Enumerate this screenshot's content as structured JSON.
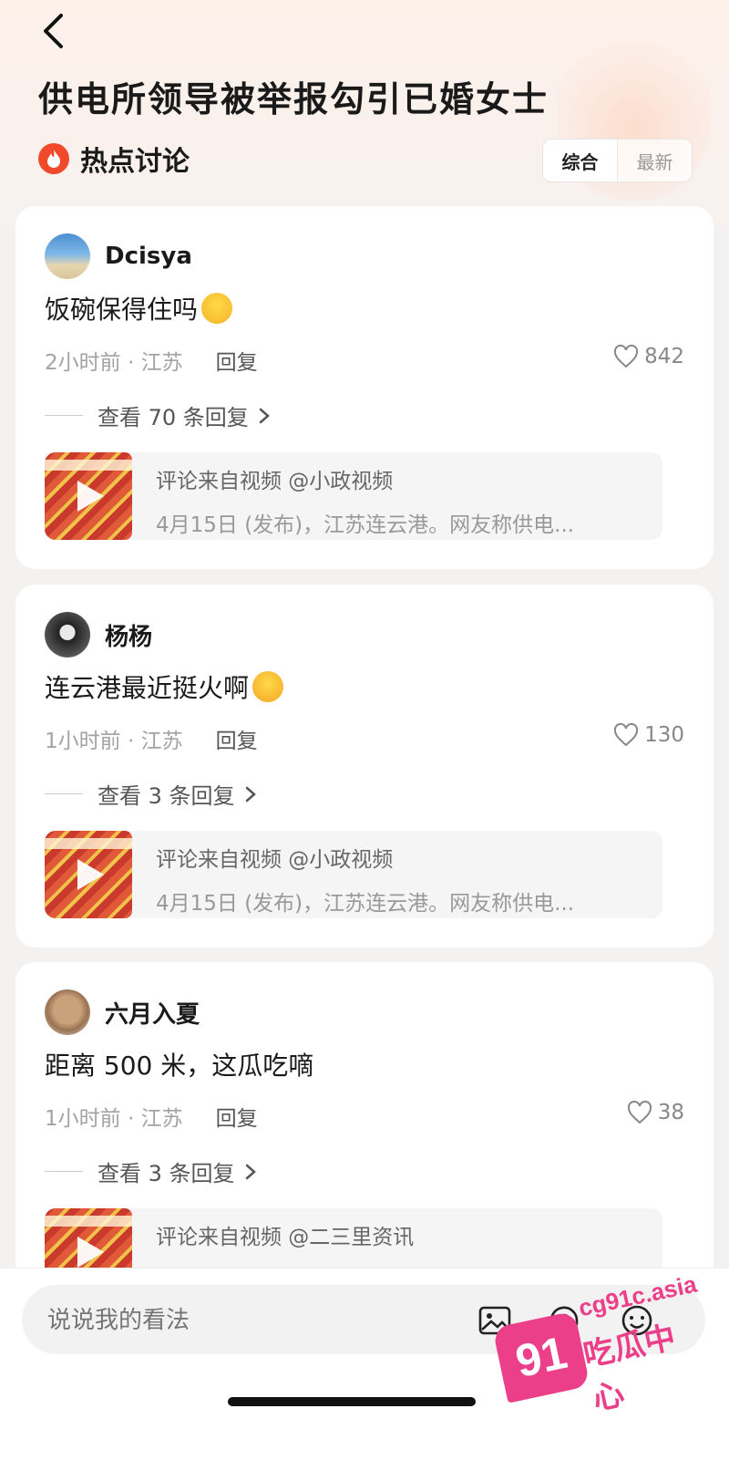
{
  "header": {
    "title": "供电所领导被举报勾引已婚女士",
    "section_title": "热点讨论",
    "sort_options": [
      "综合",
      "最新"
    ]
  },
  "comments": [
    {
      "username": "Dcisya",
      "text": "饭碗保得住吗",
      "time_location": "2小时前 · 江苏",
      "reply_label": "回复",
      "likes": "842",
      "view_replies": "查看 70 条回复",
      "video_source": "评论来自视频 @小政视频",
      "video_desc": "4月15日 (发布)，江苏连云港。网友称供电..."
    },
    {
      "username": "杨杨",
      "text": "连云港最近挺火啊",
      "time_location": "1小时前 · 江苏",
      "reply_label": "回复",
      "likes": "130",
      "view_replies": "查看 3 条回复",
      "video_source": "评论来自视频 @小政视频",
      "video_desc": "4月15日 (发布)，江苏连云港。网友称供电..."
    },
    {
      "username": "六月入夏",
      "text": "距离 500 米，这瓜吃嘀",
      "time_location": "1小时前 · 江苏",
      "reply_label": "回复",
      "likes": "38",
      "view_replies": "查看 3 条回复",
      "video_source": "评论来自视频 @二三里资讯",
      "video_desc": ""
    }
  ],
  "input": {
    "placeholder": "说说我的看法"
  },
  "watermark": {
    "url": "cg91c.asia",
    "label": "吃瓜中心",
    "badge": "91"
  },
  "colors": {
    "accent": "#f04a2b",
    "watermark": "#ec3f8a"
  }
}
